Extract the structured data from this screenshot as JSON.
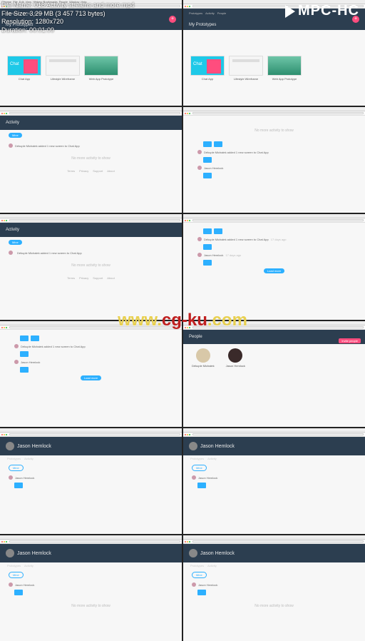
{
  "player": {
    "logo": "MPC-HC",
    "overlay": {
      "filename_label": "File Name: 018 Activity streams and more.mp4",
      "filesize_label": "File Size: 3,29 MB (3 457 713 bytes)",
      "resolution_label": "Resolution: 1280x720",
      "duration_label": "Duration: 00:01:09"
    }
  },
  "watermark": {
    "part1": "www.",
    "part2": "cg-ku",
    "part3": ".com"
  },
  "menubar": {
    "items": [
      "Chrome",
      "File",
      "Edit",
      "View",
      "History",
      "Bookmarks",
      "People",
      "Window",
      "Help"
    ]
  },
  "nav": {
    "items": [
      "Prototypes",
      "Activity",
      "People"
    ]
  },
  "prototypes": {
    "heading": "My Prototypes",
    "items": [
      {
        "label": "Chat App",
        "overlay_text": "Chat"
      },
      {
        "label": "Lifestyle Wireframe",
        "overlay_text": ""
      },
      {
        "label": "Web App Prototype",
        "overlay_text": ""
      }
    ],
    "add": "+"
  },
  "activity": {
    "heading": "Activity",
    "filter": "Mine",
    "empty": "No more activity to show",
    "sample_line": "Dékuple Michałek added 1 new screen to Chat App",
    "person2": "Jason Hemlock",
    "time1": "17 days ago",
    "time2": "17 days ago",
    "load_more": "Load more"
  },
  "people": {
    "heading": "People",
    "invite": "Invite people",
    "members": [
      {
        "name": "Dékuple Michałek"
      },
      {
        "name": "Jason Hemlock"
      }
    ]
  },
  "profile": {
    "name": "Jason Hemlock"
  },
  "footer": {
    "links": [
      "Terms",
      "Privacy",
      "Support",
      "About"
    ]
  }
}
